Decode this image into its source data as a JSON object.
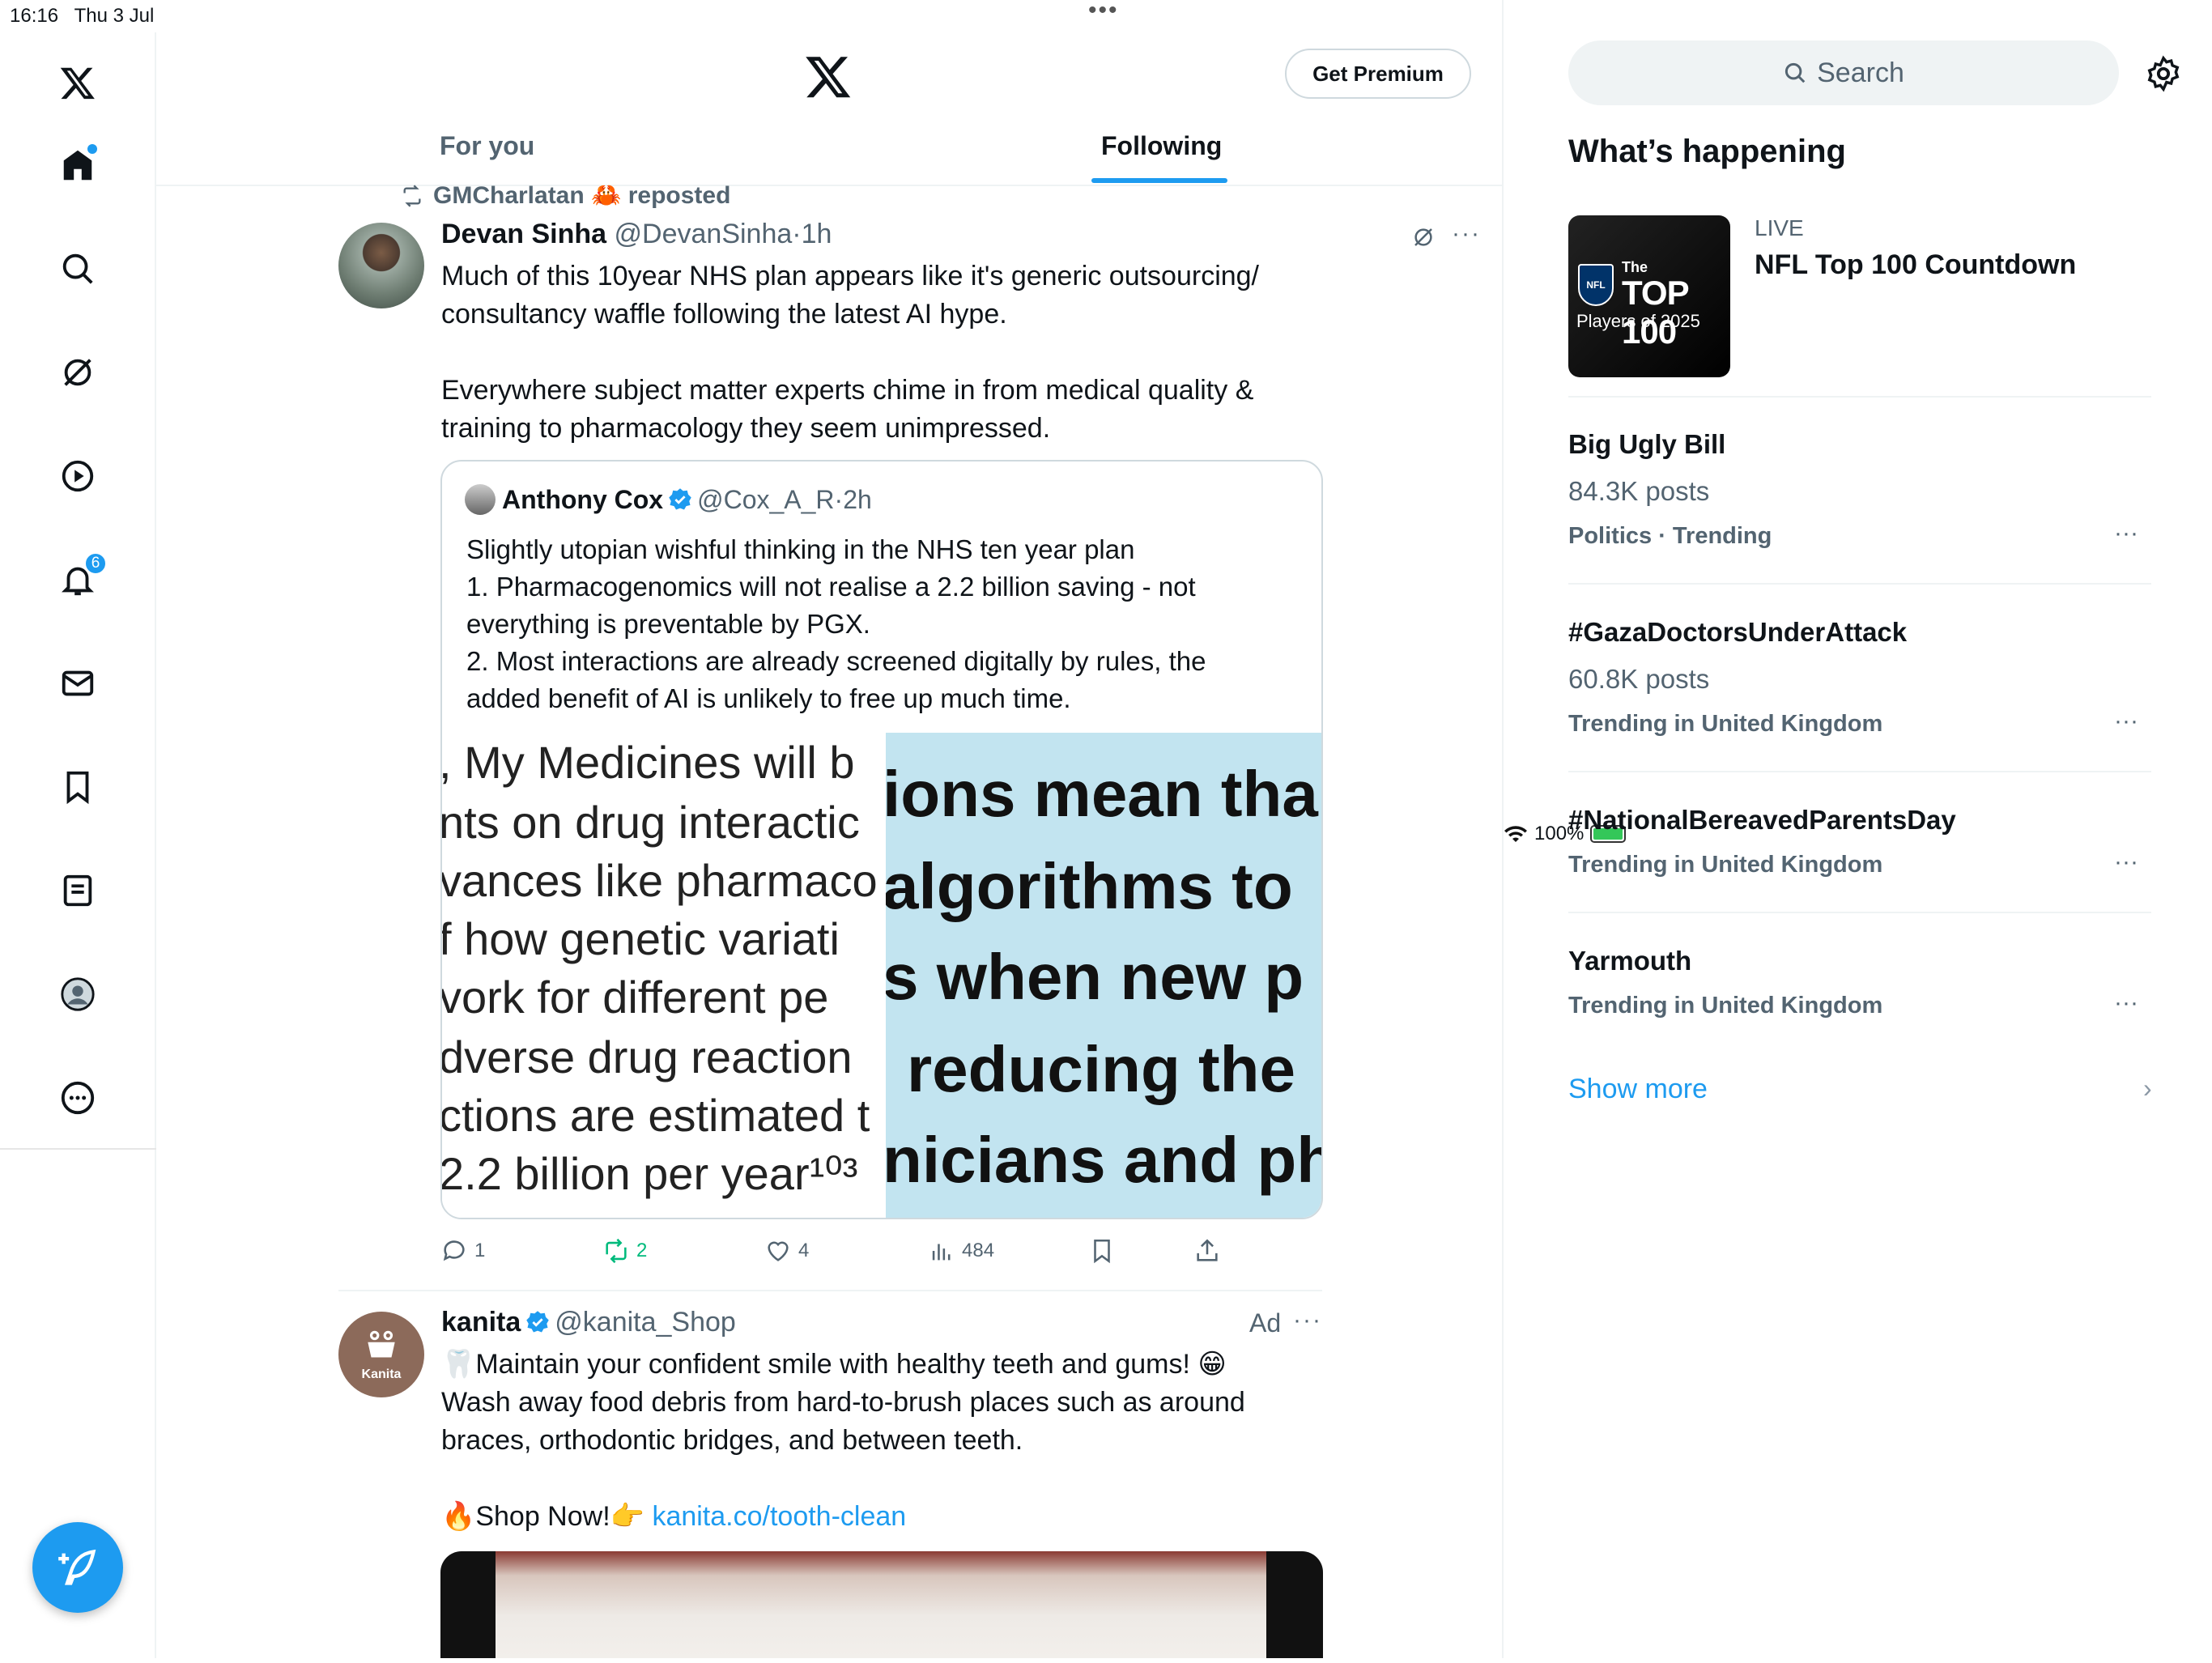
{
  "status": {
    "time": "16:16",
    "date": "Thu 3 Jul",
    "battery": "100%"
  },
  "leftnav": {
    "items": [
      "home",
      "explore",
      "grok",
      "video",
      "notifications",
      "messages",
      "bookmarks",
      "lists",
      "profile",
      "more"
    ],
    "notification_count": "6"
  },
  "header": {
    "premium_label": "Get Premium",
    "tabs": [
      {
        "label": "For you"
      },
      {
        "label": "Following"
      }
    ]
  },
  "post1": {
    "repost_label": "GMCharlatan 🦀 reposted",
    "name": "Devan Sinha",
    "handle": "@DevanSinha",
    "time": "1h",
    "text": "Much of this 10year NHS plan appears like it's generic outsourcing/\nconsultancy waffle following the latest AI hype.\n\nEverywhere subject matter experts chime in from medical quality &\ntraining to pharmacology they seem unimpressed.",
    "quote": {
      "name": "Anthony Cox",
      "handle": "@Cox_A_R",
      "time": "2h",
      "text": "Slightly utopian wishful thinking in the NHS ten year plan\n1. Pharmacogenomics will not realise a 2.2 billion saving - not\neverything is preventable by PGX.\n2. Most interactions are already screened digitally by rules, the\nadded benefit of AI is unlikely to free up much time.",
      "image_left_lines": [
        ", My Medicines will b",
        "nts on drug interactic",
        "vances like pharmaco",
        "f how genetic variati",
        "vork for different pe",
        "dverse drug reaction",
        "ctions are estimated t",
        "2.2 billion per year¹⁰³"
      ],
      "image_right_lines": [
        "ions mean tha",
        "algorithms to",
        "s when new p",
        "reducing the",
        "nicians and ph"
      ]
    },
    "actions": {
      "replies": "1",
      "reposts": "2",
      "likes": "4",
      "views": "484"
    }
  },
  "post2": {
    "avatar_label": "Kanita",
    "name": "kanita",
    "handle": "@kanita_Shop",
    "ad_label": "Ad",
    "text_line1": "🦷Maintain your confident smile with healthy teeth and gums! 😁",
    "text_body": "Wash away food debris from hard-to-brush places such as around\nbraces, orthodontic bridges, and between teeth.",
    "shop_text": "🔥Shop Now!👉 ",
    "link": "kanita.co/tooth-clean"
  },
  "sidebar": {
    "search_placeholder": "Search",
    "title": "What’s happening",
    "live": {
      "label": "LIVE",
      "title": "NFL Top 100 Countdown",
      "thumb_the": "The",
      "thumb_top": "TOP 100",
      "thumb_players": "Players of 2025",
      "thumb_logo": "NFL"
    },
    "trends": [
      {
        "title": "Big Ugly Bill",
        "posts": "84.3K posts",
        "category": "Politics · Trending"
      },
      {
        "title": "#GazaDoctorsUnderAttack",
        "posts": "60.8K posts",
        "category": "Trending in United Kingdom"
      },
      {
        "title": "#NationalBereavedParentsDay",
        "category": "Trending in United Kingdom"
      },
      {
        "title": "Yarmouth",
        "category": "Trending in United Kingdom"
      }
    ],
    "show_more": "Show more"
  },
  "colors": {
    "accent": "#1d9bf0",
    "repost_green": "#00ba7c",
    "text_secondary": "#536471"
  }
}
